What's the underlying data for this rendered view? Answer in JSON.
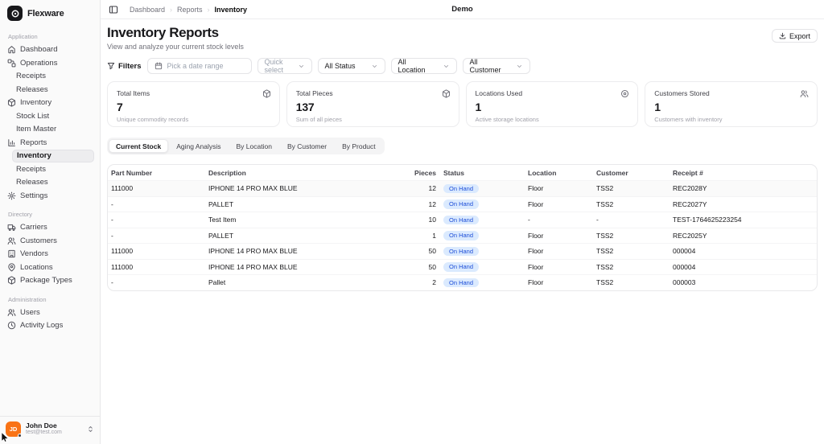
{
  "brand": {
    "name": "Flexware"
  },
  "topbar": {
    "breadcrumb": [
      "Dashboard",
      "Reports",
      "Inventory"
    ],
    "env": "Demo"
  },
  "page": {
    "title": "Inventory Reports",
    "subtitle": "View and analyze your current stock levels",
    "export_label": "Export"
  },
  "filters": {
    "label": "Filters",
    "date_placeholder": "Pick a date range",
    "selects": [
      {
        "id": "quick-select",
        "value": "Quick select",
        "muted": true,
        "width": 68
      },
      {
        "id": "status",
        "value": "All Status",
        "muted": false,
        "width": 84
      },
      {
        "id": "location",
        "value": "All Location",
        "muted": false,
        "width": 82
      },
      {
        "id": "customer",
        "value": "All Customer",
        "muted": false,
        "width": 84
      }
    ]
  },
  "stats": [
    {
      "label": "Total Items",
      "value": "7",
      "caption": "Unique commodity records",
      "icon": "package-icon"
    },
    {
      "label": "Total Pieces",
      "value": "137",
      "caption": "Sum of all pieces",
      "icon": "package-icon"
    },
    {
      "label": "Locations Used",
      "value": "1",
      "caption": "Active storage locations",
      "icon": "target-icon"
    },
    {
      "label": "Customers Stored",
      "value": "1",
      "caption": "Customers with inventory",
      "icon": "users-icon"
    }
  ],
  "tabs": [
    {
      "label": "Current Stock",
      "active": true
    },
    {
      "label": "Aging Analysis",
      "active": false
    },
    {
      "label": "By Location",
      "active": false
    },
    {
      "label": "By Customer",
      "active": false
    },
    {
      "label": "By Product",
      "active": false
    }
  ],
  "table": {
    "columns": [
      "Part Number",
      "Description",
      "Pieces",
      "Status",
      "Location",
      "Customer",
      "Receipt #"
    ],
    "rows": [
      {
        "part": "111000",
        "description": "IPHONE 14 PRO MAX BLUE",
        "pieces": "12",
        "status": "On Hand",
        "location": "Floor",
        "customer": "TSS2",
        "receipt": "REC2028Y",
        "shaded": true
      },
      {
        "part": "-",
        "description": "PALLET",
        "pieces": "12",
        "status": "On Hand",
        "location": "Floor",
        "customer": "TSS2",
        "receipt": "REC2027Y",
        "shaded": false
      },
      {
        "part": "-",
        "description": "Test Item",
        "pieces": "10",
        "status": "On Hand",
        "location": "-",
        "customer": "-",
        "receipt": "TEST-1764625223254",
        "shaded": false
      },
      {
        "part": "-",
        "description": "PALLET",
        "pieces": "1",
        "status": "On Hand",
        "location": "Floor",
        "customer": "TSS2",
        "receipt": "REC2025Y",
        "shaded": false
      },
      {
        "part": "111000",
        "description": "IPHONE 14 PRO MAX BLUE",
        "pieces": "50",
        "status": "On Hand",
        "location": "Floor",
        "customer": "TSS2",
        "receipt": "000004",
        "shaded": false
      },
      {
        "part": "111000",
        "description": "IPHONE 14 PRO MAX BLUE",
        "pieces": "50",
        "status": "On Hand",
        "location": "Floor",
        "customer": "TSS2",
        "receipt": "000004",
        "shaded": false
      },
      {
        "part": "-",
        "description": "Pallet",
        "pieces": "2",
        "status": "On Hand",
        "location": "Floor",
        "customer": "TSS2",
        "receipt": "000003",
        "shaded": false
      }
    ]
  },
  "sidebar": {
    "sections": [
      {
        "label": "Application",
        "items": [
          {
            "id": "dashboard",
            "label": "Dashboard",
            "icon": "home-icon"
          },
          {
            "id": "operations",
            "label": "Operations",
            "icon": "workflow-icon"
          },
          {
            "id": "operations-receipts",
            "label": "Receipts",
            "sub": true
          },
          {
            "id": "operations-releases",
            "label": "Releases",
            "sub": true
          },
          {
            "id": "inventory",
            "label": "Inventory",
            "icon": "package-icon"
          },
          {
            "id": "stock-list",
            "label": "Stock List",
            "sub": true
          },
          {
            "id": "item-master",
            "label": "Item Master",
            "sub": true
          },
          {
            "id": "reports",
            "label": "Reports",
            "icon": "chart-icon"
          },
          {
            "id": "reports-inventory",
            "label": "Inventory",
            "sub": true,
            "active": true
          },
          {
            "id": "reports-receipts",
            "label": "Receipts",
            "sub": true
          },
          {
            "id": "reports-releases",
            "label": "Releases",
            "sub": true
          },
          {
            "id": "settings",
            "label": "Settings",
            "icon": "gear-icon"
          }
        ]
      },
      {
        "label": "Directory",
        "items": [
          {
            "id": "carriers",
            "label": "Carriers",
            "icon": "truck-icon"
          },
          {
            "id": "customers",
            "label": "Customers",
            "icon": "users-icon"
          },
          {
            "id": "vendors",
            "label": "Vendors",
            "icon": "building-icon"
          },
          {
            "id": "locations",
            "label": "Locations",
            "icon": "map-pin-icon"
          },
          {
            "id": "package-types",
            "label": "Package Types",
            "icon": "package-icon"
          }
        ]
      },
      {
        "label": "Administration",
        "items": [
          {
            "id": "users",
            "label": "Users",
            "icon": "users-icon"
          },
          {
            "id": "activity-logs",
            "label": "Activity Logs",
            "icon": "clock-icon"
          }
        ]
      }
    ],
    "user": {
      "initials": "JD",
      "name": "John Doe",
      "email": "test@test.com"
    }
  },
  "colors": {
    "badge_bg": "#dbeafe",
    "badge_text": "#1d4ed8",
    "avatar": "#f97316",
    "brand": "#18181b",
    "sidebar_bg": "#fafafa"
  }
}
